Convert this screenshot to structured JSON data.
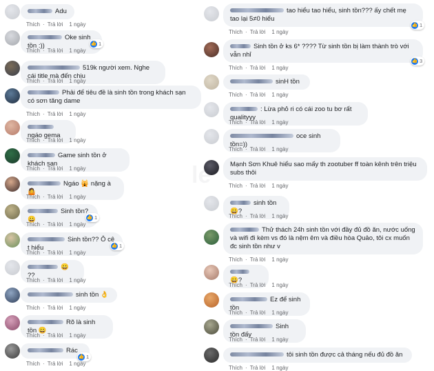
{
  "common": {
    "like_label": "Thích",
    "reply_label": "Trả lời",
    "like_icon": "thumbs-up-icon",
    "colors": {
      "bubble": "#f0f2f5",
      "link": "#65676b",
      "like_blue": "#1877f2"
    }
  },
  "left_comments": [
    {
      "text": "Adu",
      "time": "1 ngày",
      "react": ""
    },
    {
      "text": "Oke sinh tồn :))",
      "time": "1 ngày",
      "react": "1"
    },
    {
      "text": "519k người xem. Nghe cái title mà đến chịu",
      "time": "1 ngày",
      "react": ""
    },
    {
      "text": "Phải để tiêu đề là sinh tồn trong khách sạn có sơn tăng dame",
      "time": "1 ngày",
      "react": ""
    },
    {
      "text": "ngáo gema",
      "time": "1 ngày",
      "react": ""
    },
    {
      "text": "Game sinh tồn ở khách sạn",
      "time": "1 ngày",
      "react": ""
    },
    {
      "text": "Ngáo 🙀 nặng à 🤷",
      "time": "1 ngày",
      "react": ""
    },
    {
      "text": "Sinh tồn? 😀",
      "time": "1 ngày",
      "react": "1"
    },
    {
      "text": "Sinh tồn?? Ô cê t hiểu",
      "time": "1 ngày",
      "react": "1"
    },
    {
      "text": "😀 ??",
      "time": "1 ngày",
      "react": ""
    },
    {
      "text": "sinh tồn 👌",
      "time": "1 ngày",
      "react": ""
    },
    {
      "text": "Rõ là sinh tồn 😀",
      "time": "1 ngày",
      "react": ""
    },
    {
      "text": "Rác",
      "time": "1 ngày",
      "react": "1"
    }
  ],
  "right_comments": [
    {
      "text": "tao hiểu tao hiểu, sinh tồn??? ấy chết mẹ tao lại 5≠0 hiểu",
      "time": "1 ngày",
      "react": "1"
    },
    {
      "text": "Sinh tồn ở ks 6* ???? Từ sinh tồn bị làm thành trò với vẫn nhỉ",
      "time": "1 ngày",
      "react": "3"
    },
    {
      "text": "sinH tồn",
      "time": "1 ngày",
      "react": ""
    },
    {
      "text": ": Lừa phỏ ri có cái zoo tu bơ rất qualityyy",
      "time": "1 ngày",
      "react": ""
    },
    {
      "text": "oce sinh tồn=))",
      "time": "1 ngày",
      "react": ""
    },
    {
      "text": "Mạnh Sơn Khuê hiểu sao mấy th zootuber ff toàn kênh trên triệu subs thôi",
      "time": "1 ngày",
      "react": ""
    },
    {
      "text": "sinh tồn 😀?",
      "time": "1 ngày",
      "react": ""
    },
    {
      "text": "Thử thách 24h sinh tồn với đầy đủ đồ ăn, nước uống và wifi đi kèm vs đó là nệm êm và điều hòa Quảo, tôi cx muốn đc sinh tồn như v",
      "time": "1 ngày",
      "react": ""
    },
    {
      "text": "😀?",
      "time": "1 ngày",
      "react": ""
    },
    {
      "text": "Ez để sinh tồn",
      "time": "1 ngày",
      "react": ""
    },
    {
      "text": "Sinh tồn đấy",
      "time": "1 ngày",
      "react": ""
    },
    {
      "text": "tôi sinh tồn được cả tháng nếu đủ đồ ăn",
      "time": "1 ngày",
      "react": ""
    }
  ]
}
